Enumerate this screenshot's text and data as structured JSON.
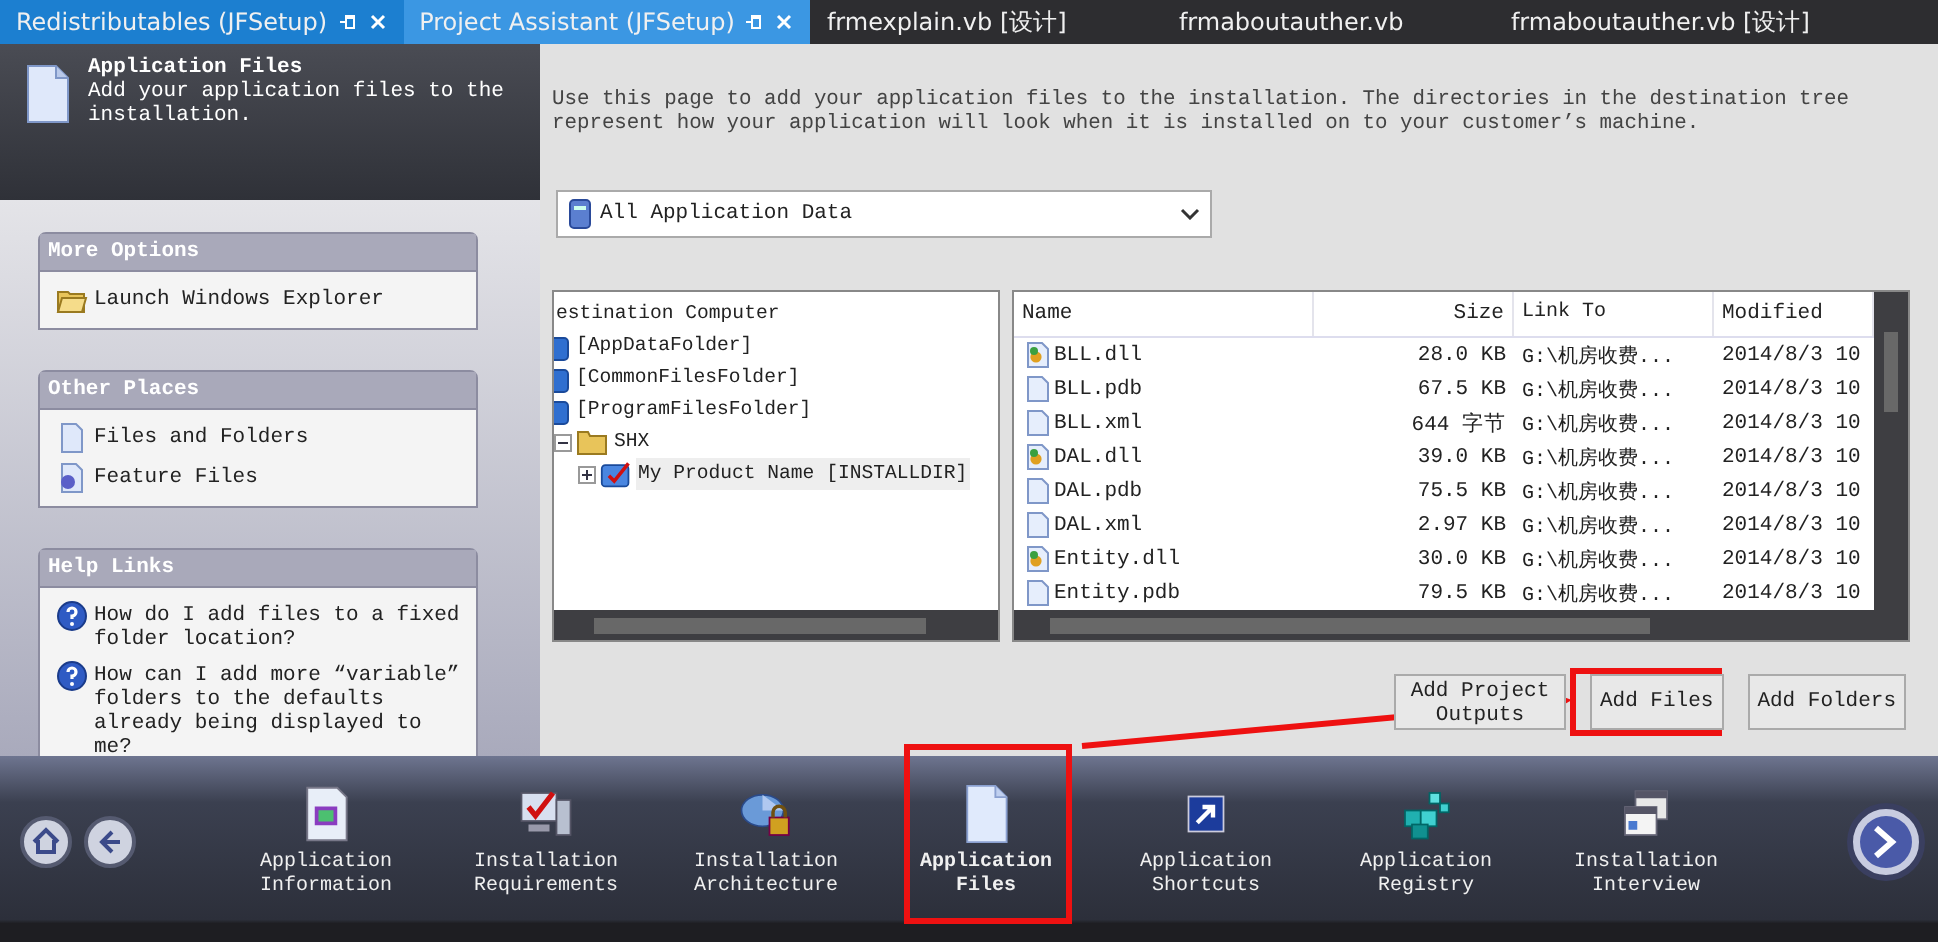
{
  "tabs": [
    {
      "label": "Redistributables (JFSetup)",
      "selected": true,
      "pinnable": true
    },
    {
      "label": "Project Assistant (JFSetup)",
      "selected": false,
      "pinnable": true
    },
    {
      "label": "frmexplain.vb [设计]",
      "selected": false,
      "pinnable": false
    },
    {
      "label": "frmaboutauther.vb",
      "selected": false,
      "pinnable": false
    },
    {
      "label": "frmaboutauther.vb [设计]",
      "selected": false,
      "pinnable": false
    }
  ],
  "page_header": {
    "title": "Application Files",
    "subtitle": "Add your application files to the installation."
  },
  "sidebar": [
    {
      "title": "More Options",
      "items": [
        {
          "text": "Launch Windows Explorer",
          "kind": "explorer"
        }
      ]
    },
    {
      "title": "Other Places",
      "items": [
        {
          "text": "Files and Folders",
          "kind": "file"
        },
        {
          "text": "Feature Files",
          "kind": "feature"
        }
      ]
    },
    {
      "title": "Help Links",
      "items": [
        {
          "text": "How do I add files to a fixed folder location?",
          "kind": "help"
        },
        {
          "text": "How can I add more “variable” folders to the defaults already being displayed to me?",
          "kind": "help"
        }
      ]
    }
  ],
  "description": "Use this page to add your application files to the installation. The directories in the destination tree represent how your application will look when it is installed on to your customer’s machine.",
  "dropdown": {
    "value": "All Application Data"
  },
  "tree": {
    "label": "estination Computer",
    "children": [
      {
        "label": "[AppDataFolder]",
        "kind": "system",
        "selected": false
      },
      {
        "label": "[CommonFilesFolder]",
        "kind": "system",
        "selected": false
      },
      {
        "label": "[ProgramFilesFolder]",
        "kind": "system",
        "selected": false
      },
      {
        "label": "SHX",
        "kind": "folder",
        "expanded": true,
        "selected": false,
        "children": [
          {
            "label": "My Product Name [INSTALLDIR]",
            "kind": "product",
            "expanded": false,
            "selected": true
          }
        ]
      }
    ]
  },
  "file_list": {
    "columns": [
      "Name",
      "Size",
      "Link To",
      "Modified"
    ],
    "rows": [
      {
        "name": "BLL.dll",
        "kind": "dll",
        "size": "28.0 KB",
        "link": "G:\\机房收费...",
        "modified": "2014/8/3 10"
      },
      {
        "name": "BLL.pdb",
        "kind": "file",
        "size": "67.5 KB",
        "link": "G:\\机房收费...",
        "modified": "2014/8/3 10"
      },
      {
        "name": "BLL.xml",
        "kind": "file",
        "size": "644 字节",
        "link": "G:\\机房收费...",
        "modified": "2014/8/3 10"
      },
      {
        "name": "DAL.dll",
        "kind": "dll",
        "size": "39.0 KB",
        "link": "G:\\机房收费...",
        "modified": "2014/8/3 10"
      },
      {
        "name": "DAL.pdb",
        "kind": "file",
        "size": "75.5 KB",
        "link": "G:\\机房收费...",
        "modified": "2014/8/3 10"
      },
      {
        "name": "DAL.xml",
        "kind": "file",
        "size": "2.97 KB",
        "link": "G:\\机房收费...",
        "modified": "2014/8/3 10"
      },
      {
        "name": "Entity.dll",
        "kind": "dll",
        "size": "30.0 KB",
        "link": "G:\\机房收费...",
        "modified": "2014/8/3 10"
      },
      {
        "name": "Entity.pdb",
        "kind": "file",
        "size": "79.5 KB",
        "link": "G:\\机房收费...",
        "modified": "2014/8/3 10"
      }
    ]
  },
  "buttons": [
    "Add Project Outputs",
    "Add Files",
    "Add Folders"
  ],
  "nav_items": [
    {
      "label": "Application Information",
      "kind": "info",
      "selected": false
    },
    {
      "label": "Installation Requirements",
      "kind": "requirements",
      "selected": false
    },
    {
      "label": "Installation Architecture",
      "kind": "architecture",
      "selected": false
    },
    {
      "label": "Application Files",
      "kind": "files",
      "selected": true
    },
    {
      "label": "Application Shortcuts",
      "kind": "shortcut",
      "selected": false
    },
    {
      "label": "Application Registry",
      "kind": "registry",
      "selected": false
    },
    {
      "label": "Installation Interview",
      "kind": "interview",
      "selected": false
    }
  ]
}
